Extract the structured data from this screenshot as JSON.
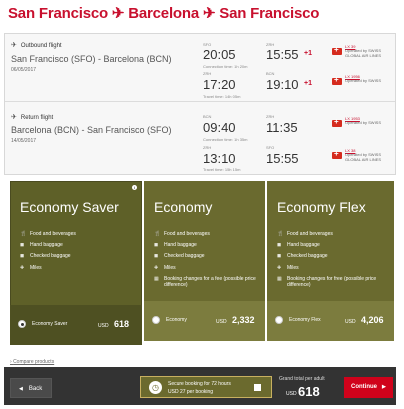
{
  "title": "San Francisco ✈ Barcelona ✈ San Francisco",
  "outbound": {
    "heading": "Outbound flight",
    "route": "San Francisco (SFO) - Barcelona (BCN)",
    "date": "06/05/2017",
    "leg1": {
      "from": "SFO",
      "dep": "20:05",
      "to": "ZRH",
      "arr": "15:55",
      "plus": "+1",
      "note": "Connection time: 1h 20m",
      "flight": "LX 39",
      "operator": "Operated by SWISS GLOBAL AIR LINES"
    },
    "leg2": {
      "from": "ZRH",
      "dep": "17:20",
      "to": "BCN",
      "arr": "19:10",
      "plus": "+1",
      "note": "Travel time: 14h 05m",
      "flight": "LX 1956",
      "operator": "Operated by SWISS"
    }
  },
  "return": {
    "heading": "Return flight",
    "route": "Barcelona (BCN) - San Francisco (SFO)",
    "date": "14/05/2017",
    "leg1": {
      "from": "BCN",
      "dep": "09:40",
      "to": "ZRH",
      "arr": "11:35",
      "note": "Connection time: 1h 35m",
      "flight": "LX 1953",
      "operator": "Operated by SWISS"
    },
    "leg2": {
      "from": "ZRH",
      "dep": "13:10",
      "to": "SFO",
      "arr": "15:55",
      "note": "Travel time: 15h 15m",
      "flight": "LX 38",
      "operator": "Operated by SWISS GLOBAL AIR LINES"
    }
  },
  "fares": [
    {
      "name": "Economy Saver",
      "features": [
        "Food and beverages",
        "Hand baggage",
        "Checked baggage",
        "Miles"
      ],
      "extra": "",
      "label": "Economy Saver",
      "currency": "USD",
      "price": "618",
      "selected": true
    },
    {
      "name": "Economy",
      "features": [
        "Food and beverages",
        "Hand baggage",
        "Checked baggage",
        "Miles"
      ],
      "extra": "Booking changes for a fee (possible price difference)",
      "label": "Economy",
      "currency": "USD",
      "price": "2,332",
      "selected": false
    },
    {
      "name": "Economy Flex",
      "features": [
        "Food and beverages",
        "Hand baggage",
        "Checked baggage",
        "Miles"
      ],
      "extra": "Booking changes for free (possible price difference)",
      "label": "Economy Flex",
      "currency": "USD",
      "price": "4,206",
      "selected": false
    }
  ],
  "compare": "Compare products",
  "bottom": {
    "back": "Back",
    "secure_title": "Secure booking for 72 hours",
    "secure_sub": "USD 27 per booking",
    "grand_label": "Grand total per adult",
    "grand_currency": "USD",
    "grand_price": "618",
    "continue": "Continue"
  },
  "colors": {
    "brand_red": "#c8102e",
    "fare_olive": "#6a6a2f",
    "bar_dark": "#333333"
  }
}
